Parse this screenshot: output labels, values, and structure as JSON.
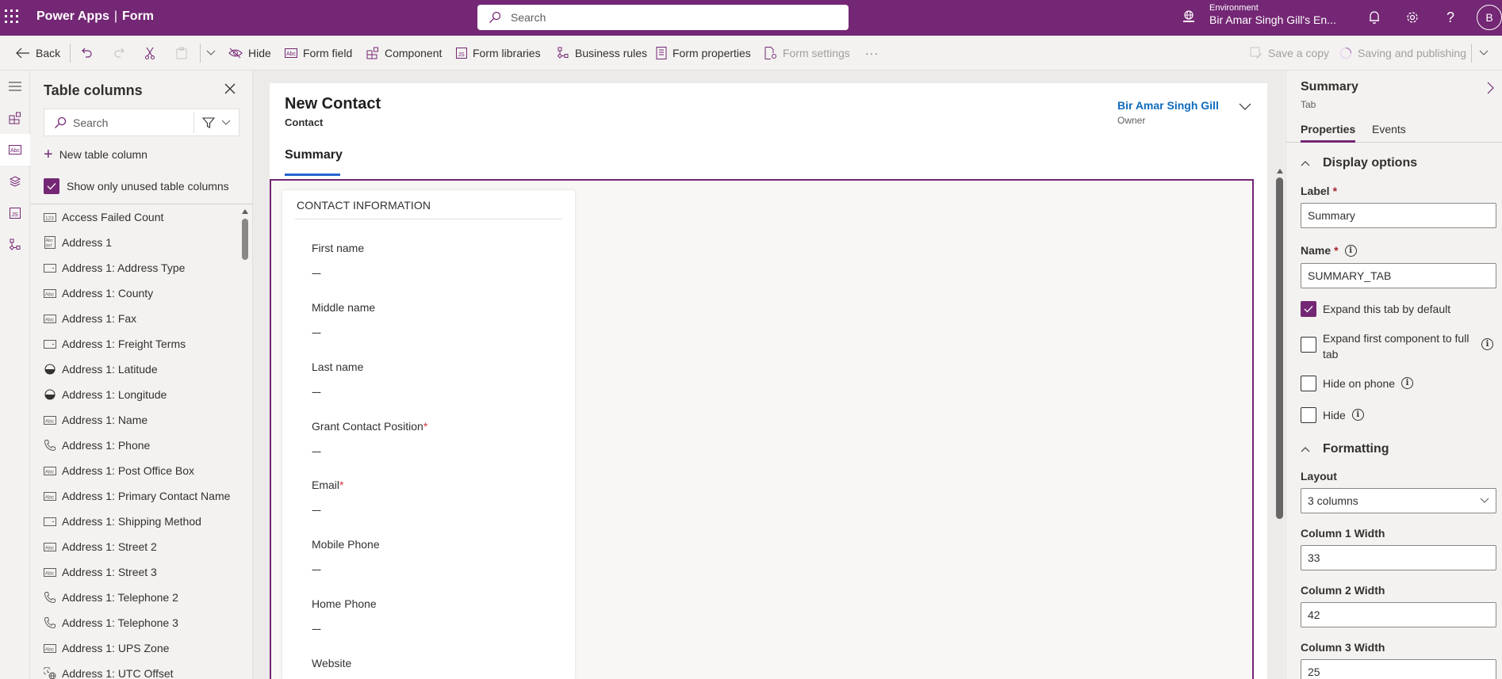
{
  "header": {
    "app_name": "Power Apps",
    "separator": "|",
    "section": "Form",
    "search_placeholder": "Search",
    "environment_label": "Environment",
    "environment_value": "Bir Amar Singh Gill's En...",
    "avatar_initial": "B",
    "accent_color": "#742774"
  },
  "toolbar": {
    "back": "Back",
    "hide": "Hide",
    "form_field": "Form field",
    "component": "Component",
    "form_libraries": "Form libraries",
    "business_rules": "Business rules",
    "form_properties": "Form properties",
    "form_settings": "Form settings",
    "more": "···",
    "save_copy": "Save a copy",
    "saving": "Saving and publishing"
  },
  "columns_pane": {
    "title": "Table columns",
    "search_placeholder": "Search",
    "new_column": "New table column",
    "show_unused_label": "Show only unused table columns",
    "show_unused_checked": true,
    "items": [
      {
        "label": "Access Failed Count",
        "icon": "number-icon"
      },
      {
        "label": "Address 1",
        "icon": "multiline-text-icon"
      },
      {
        "label": "Address 1: Address Type",
        "icon": "choice-icon"
      },
      {
        "label": "Address 1: County",
        "icon": "text-icon"
      },
      {
        "label": "Address 1: Fax",
        "icon": "text-icon"
      },
      {
        "label": "Address 1: Freight Terms",
        "icon": "choice-icon"
      },
      {
        "label": "Address 1: Latitude",
        "icon": "float-icon"
      },
      {
        "label": "Address 1: Longitude",
        "icon": "float-icon"
      },
      {
        "label": "Address 1: Name",
        "icon": "text-icon"
      },
      {
        "label": "Address 1: Phone",
        "icon": "phone-icon"
      },
      {
        "label": "Address 1: Post Office Box",
        "icon": "text-icon"
      },
      {
        "label": "Address 1: Primary Contact Name",
        "icon": "text-icon"
      },
      {
        "label": "Address 1: Shipping Method",
        "icon": "choice-icon"
      },
      {
        "label": "Address 1: Street 2",
        "icon": "text-icon"
      },
      {
        "label": "Address 1: Street 3",
        "icon": "text-icon"
      },
      {
        "label": "Address 1: Telephone 2",
        "icon": "phone-icon"
      },
      {
        "label": "Address 1: Telephone 3",
        "icon": "phone-icon"
      },
      {
        "label": "Address 1: UPS Zone",
        "icon": "text-icon"
      },
      {
        "label": "Address 1: UTC Offset",
        "icon": "timezone-icon"
      }
    ]
  },
  "form": {
    "title": "New Contact",
    "entity": "Contact",
    "owner_name": "Bir Amar Singh Gill",
    "owner_label": "Owner",
    "tab_label": "Summary",
    "section_title": "CONTACT INFORMATION",
    "fields": [
      {
        "label": "First name",
        "required": false,
        "value": "---"
      },
      {
        "label": "Middle name",
        "required": false,
        "value": "---"
      },
      {
        "label": "Last name",
        "required": false,
        "value": "---"
      },
      {
        "label": "Grant Contact Position",
        "required": true,
        "value": "---"
      },
      {
        "label": "Email",
        "required": true,
        "value": "---"
      },
      {
        "label": "Mobile Phone",
        "required": false,
        "value": "---"
      },
      {
        "label": "Home Phone",
        "required": false,
        "value": "---"
      },
      {
        "label": "Website",
        "required": false,
        "value": ""
      }
    ]
  },
  "properties": {
    "title": "Summary",
    "subtitle": "Tab",
    "tabs": [
      "Properties",
      "Events"
    ],
    "display_options": "Display options",
    "label_caption": "Label",
    "label_value": "Summary",
    "name_caption": "Name",
    "name_value": "SUMMARY_TAB",
    "required_mark": "*",
    "checks": [
      {
        "label": "Expand this tab by default",
        "checked": true,
        "info": false
      },
      {
        "label": "Expand first component to full tab",
        "checked": false,
        "info": true
      },
      {
        "label": "Hide on phone",
        "checked": false,
        "info": true
      },
      {
        "label": "Hide",
        "checked": false,
        "info": true
      }
    ],
    "formatting": "Formatting",
    "layout_caption": "Layout",
    "layout_value": "3 columns",
    "col1_caption": "Column 1 Width",
    "col1_value": "33",
    "col2_caption": "Column 2 Width",
    "col2_value": "42",
    "col3_caption": "Column 3 Width",
    "col3_value": "25"
  }
}
